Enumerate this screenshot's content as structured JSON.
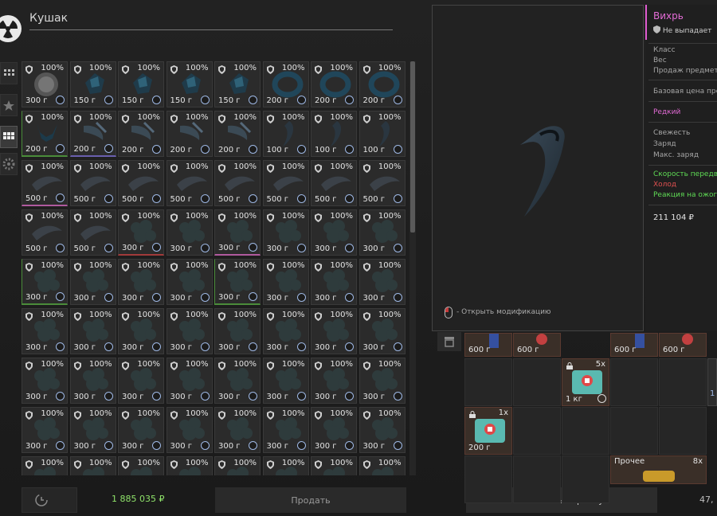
{
  "header": {
    "title": "Кушак"
  },
  "side_tabs": [
    "grid-small-icon",
    "star-icon",
    "grid-large-icon",
    "cog-icon"
  ],
  "grid": {
    "rows": [
      {
        "cells": [
          {
            "pct": "100%",
            "wt": "300 г",
            "art": "blur",
            "border": ""
          },
          {
            "pct": "100%",
            "wt": "150 г",
            "art": "gem",
            "border": ""
          },
          {
            "pct": "100%",
            "wt": "150 г",
            "art": "gem",
            "border": ""
          },
          {
            "pct": "100%",
            "wt": "150 г",
            "art": "gem",
            "border": ""
          },
          {
            "pct": "100%",
            "wt": "150 г",
            "art": "gem",
            "border": ""
          },
          {
            "pct": "100%",
            "wt": "200 г",
            "art": "ring",
            "border": ""
          },
          {
            "pct": "100%",
            "wt": "200 г",
            "art": "ring",
            "border": ""
          },
          {
            "pct": "100%",
            "wt": "200 г",
            "art": "ring",
            "border": ""
          }
        ]
      },
      {
        "cells": [
          {
            "pct": "100%",
            "wt": "200 г",
            "art": "fork",
            "border": "green"
          },
          {
            "pct": "100%",
            "wt": "200 г",
            "art": "claw",
            "border": "purple"
          },
          {
            "pct": "100%",
            "wt": "200 г",
            "art": "claw",
            "border": ""
          },
          {
            "pct": "100%",
            "wt": "200 г",
            "art": "claw",
            "border": ""
          },
          {
            "pct": "100%",
            "wt": "200 г",
            "art": "claw",
            "border": ""
          },
          {
            "pct": "100%",
            "wt": "100 г",
            "art": "fang",
            "border": ""
          },
          {
            "pct": "100%",
            "wt": "100 г",
            "art": "fang",
            "border": ""
          },
          {
            "pct": "100%",
            "wt": "100 г",
            "art": "fang",
            "border": ""
          }
        ]
      },
      {
        "cells": [
          {
            "pct": "100%",
            "wt": "500 г",
            "art": "horn",
            "border": "pink"
          },
          {
            "pct": "100%",
            "wt": "500 г",
            "art": "horn",
            "border": ""
          },
          {
            "pct": "100%",
            "wt": "500 г",
            "art": "horn",
            "border": ""
          },
          {
            "pct": "100%",
            "wt": "500 г",
            "art": "horn",
            "border": ""
          },
          {
            "pct": "100%",
            "wt": "500 г",
            "art": "horn",
            "border": ""
          },
          {
            "pct": "100%",
            "wt": "500 г",
            "art": "horn",
            "border": ""
          },
          {
            "pct": "100%",
            "wt": "500 г",
            "art": "horn",
            "border": ""
          },
          {
            "pct": "100%",
            "wt": "500 г",
            "art": "horn",
            "border": ""
          }
        ]
      },
      {
        "cells": [
          {
            "pct": "100%",
            "wt": "500 г",
            "art": "horn",
            "border": ""
          },
          {
            "pct": "100%",
            "wt": "500 г",
            "art": "horn",
            "border": ""
          },
          {
            "pct": "100%",
            "wt": "300 г",
            "art": "moss",
            "border": "red"
          },
          {
            "pct": "100%",
            "wt": "300 г",
            "art": "moss",
            "border": ""
          },
          {
            "pct": "100%",
            "wt": "300 г",
            "art": "moss",
            "border": "pink"
          },
          {
            "pct": "100%",
            "wt": "300 г",
            "art": "moss",
            "border": ""
          },
          {
            "pct": "100%",
            "wt": "300 г",
            "art": "moss",
            "border": ""
          },
          {
            "pct": "100%",
            "wt": "300 г",
            "art": "moss",
            "border": ""
          }
        ]
      },
      {
        "cells": [
          {
            "pct": "100%",
            "wt": "300 г",
            "art": "moss",
            "border": "green"
          },
          {
            "pct": "100%",
            "wt": "300 г",
            "art": "moss",
            "border": ""
          },
          {
            "pct": "100%",
            "wt": "300 г",
            "art": "moss",
            "border": ""
          },
          {
            "pct": "100%",
            "wt": "300 г",
            "art": "moss",
            "border": ""
          },
          {
            "pct": "100%",
            "wt": "300 г",
            "art": "moss",
            "border": "green"
          },
          {
            "pct": "100%",
            "wt": "300 г",
            "art": "moss",
            "border": ""
          },
          {
            "pct": "100%",
            "wt": "300 г",
            "art": "moss",
            "border": ""
          },
          {
            "pct": "100%",
            "wt": "300 г",
            "art": "moss",
            "border": ""
          }
        ]
      },
      {
        "cells": [
          {
            "pct": "100%",
            "wt": "300 г",
            "art": "moss",
            "border": ""
          },
          {
            "pct": "100%",
            "wt": "300 г",
            "art": "moss",
            "border": ""
          },
          {
            "pct": "100%",
            "wt": "300 г",
            "art": "moss",
            "border": ""
          },
          {
            "pct": "100%",
            "wt": "300 г",
            "art": "moss",
            "border": ""
          },
          {
            "pct": "100%",
            "wt": "300 г",
            "art": "moss",
            "border": ""
          },
          {
            "pct": "100%",
            "wt": "300 г",
            "art": "moss",
            "border": ""
          },
          {
            "pct": "100%",
            "wt": "300 г",
            "art": "moss",
            "border": ""
          },
          {
            "pct": "100%",
            "wt": "300 г",
            "art": "moss",
            "border": ""
          }
        ]
      },
      {
        "cells": [
          {
            "pct": "100%",
            "wt": "300 г",
            "art": "moss",
            "border": ""
          },
          {
            "pct": "100%",
            "wt": "300 г",
            "art": "moss",
            "border": ""
          },
          {
            "pct": "100%",
            "wt": "300 г",
            "art": "moss",
            "border": ""
          },
          {
            "pct": "100%",
            "wt": "300 г",
            "art": "moss",
            "border": ""
          },
          {
            "pct": "100%",
            "wt": "300 г",
            "art": "moss",
            "border": ""
          },
          {
            "pct": "100%",
            "wt": "300 г",
            "art": "moss",
            "border": ""
          },
          {
            "pct": "100%",
            "wt": "300 г",
            "art": "moss",
            "border": ""
          },
          {
            "pct": "100%",
            "wt": "300 г",
            "art": "moss",
            "border": ""
          }
        ]
      },
      {
        "cells": [
          {
            "pct": "100%",
            "wt": "300 г",
            "art": "moss",
            "border": ""
          },
          {
            "pct": "100%",
            "wt": "300 г",
            "art": "moss",
            "border": ""
          },
          {
            "pct": "100%",
            "wt": "300 г",
            "art": "moss",
            "border": ""
          },
          {
            "pct": "100%",
            "wt": "300 г",
            "art": "moss",
            "border": ""
          },
          {
            "pct": "100%",
            "wt": "300 г",
            "art": "moss",
            "border": ""
          },
          {
            "pct": "100%",
            "wt": "300 г",
            "art": "moss",
            "border": ""
          },
          {
            "pct": "100%",
            "wt": "300 г",
            "art": "moss",
            "border": ""
          },
          {
            "pct": "100%",
            "wt": "300 г",
            "art": "moss",
            "border": ""
          }
        ]
      },
      {
        "cells": [
          {
            "pct": "100%",
            "wt": "",
            "art": "moss",
            "border": ""
          },
          {
            "pct": "100%",
            "wt": "",
            "art": "moss",
            "border": ""
          },
          {
            "pct": "100%",
            "wt": "",
            "art": "moss",
            "border": ""
          },
          {
            "pct": "100%",
            "wt": "",
            "art": "moss",
            "border": ""
          },
          {
            "pct": "100%",
            "wt": "",
            "art": "moss",
            "border": ""
          },
          {
            "pct": "100%",
            "wt": "",
            "art": "moss",
            "border": ""
          },
          {
            "pct": "100%",
            "wt": "",
            "art": "moss",
            "border": ""
          },
          {
            "pct": "100%",
            "wt": "",
            "art": "moss",
            "border": ""
          }
        ]
      }
    ]
  },
  "footer": {
    "balance": "1 885 035 ₽",
    "sell_label": "Продать",
    "clear_cart_label": "Очистить корзину",
    "weight": "47,"
  },
  "preview": {
    "hint": "- Открыть модификацию"
  },
  "info": {
    "name": "Вихрь",
    "drop_note": "Не выпадает",
    "rows_group1": [
      "Класс",
      "Вес",
      "Продаж предмет"
    ],
    "base_price_label": "Базовая цена пре",
    "rarity": "Редкий",
    "rows_group2": [
      "Свежесть",
      "Заряд",
      "Макс. заряд"
    ],
    "effects": [
      {
        "text": "Скорость передв",
        "color": "#5fdc55"
      },
      {
        "text": "Холод",
        "color": "#e05050"
      },
      {
        "text": "Реакция на ожог",
        "color": "#5fdc55"
      }
    ],
    "price": "211 104 ₽"
  },
  "inventory": {
    "top_items": [
      {
        "label": "600 г",
        "art": "flask"
      },
      {
        "label": "600 г",
        "art": "medal"
      },
      {
        "label": "600 г",
        "art": "flask"
      },
      {
        "label": "600 г",
        "art": "medal"
      }
    ],
    "medkit_a": {
      "label": "1 кг",
      "count": "5x"
    },
    "medkit_b": {
      "label": "200 г",
      "count": "1x"
    },
    "misc": {
      "label": "Прочее",
      "count": "8x"
    },
    "side_value": "1"
  },
  "colors": {
    "accent_pink": "#e36bd6",
    "money_green": "#8fe36a",
    "clock_blue": "#9fb9e6"
  }
}
